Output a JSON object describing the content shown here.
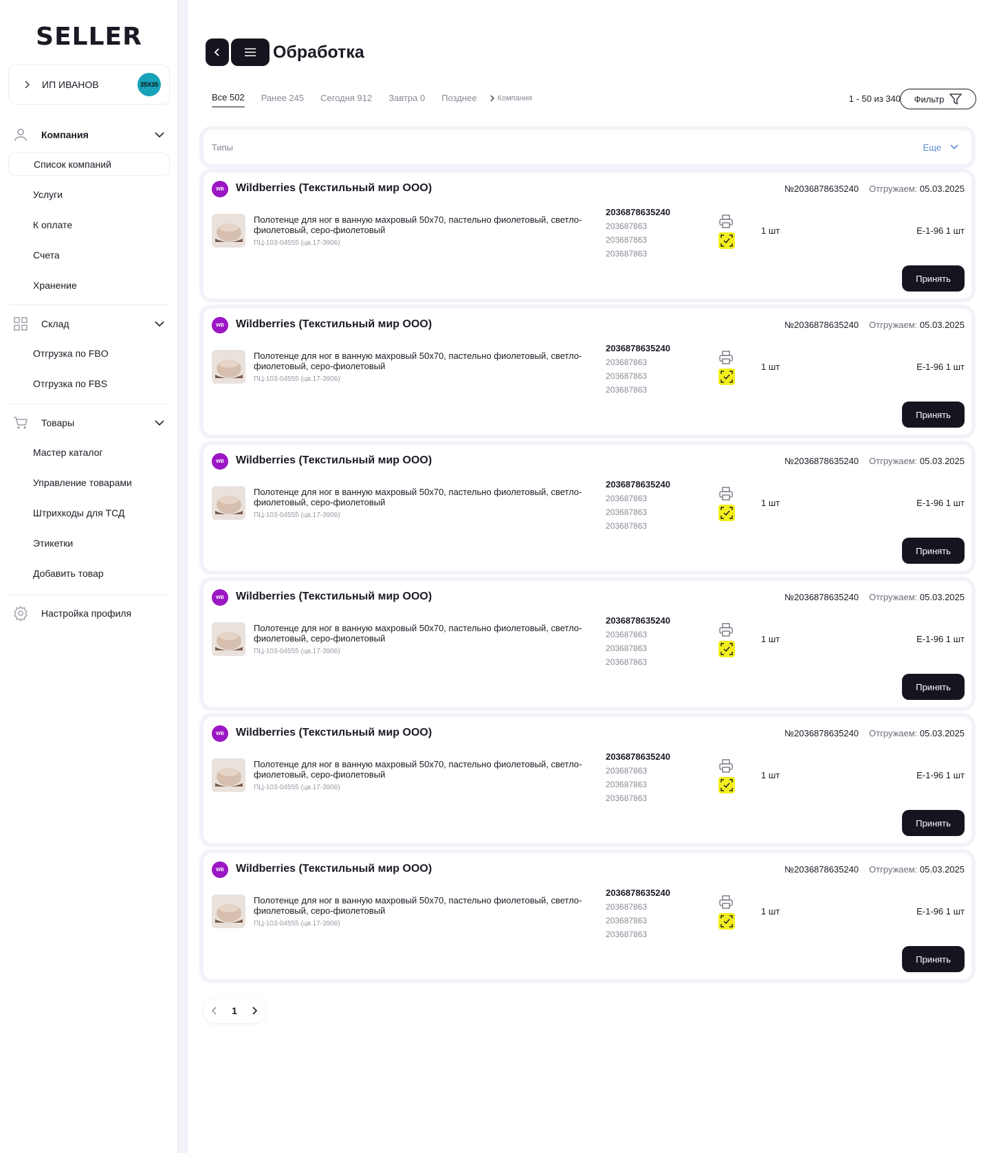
{
  "brand": "SELLER",
  "account": {
    "name": "ИП ИВАНОВ",
    "avatar_text": "35Х35"
  },
  "sidebar": {
    "company": {
      "label": "Компания",
      "items": [
        "Список компаний",
        "Услуги",
        "К оплате",
        "Счета",
        "Хранение"
      ]
    },
    "warehouse": {
      "label": "Склад",
      "items": [
        "Отгрузка по FBO",
        "Отгрузка по FBS"
      ]
    },
    "goods": {
      "label": "Товары",
      "items": [
        "Мастер каталог",
        "Управление товарами",
        "Штрихкоды для ТСД",
        "Этикетки",
        "Добавить товар"
      ]
    },
    "settings": {
      "label": "Настройка профиля"
    }
  },
  "header": {
    "title": "Обработка",
    "tabs": [
      "Все 502",
      "Ранее 245",
      "Сегодня 912",
      "Завтра 0",
      "Позднее"
    ],
    "crumb": "Компания",
    "range": "1 - 50 из 340",
    "filter_label": "Фильтр"
  },
  "types": {
    "label": "Типы",
    "more": "Еще"
  },
  "order_card": {
    "brand_badge": "WB",
    "shop": "Wildberries (Текстильный мир ООО)",
    "order_no": "№2036878635240",
    "ship_label": "Отгружаем:",
    "ship_date": "05.03.2025",
    "product": "Полотенце для ног в ванную махровый 50x70, пастельно фиолетовый, светло-фиолетовый, серо-фиолетовый",
    "sku": "ПЦ-103-04555 (цв.17-3906)",
    "code_main": "2036878635240",
    "codes": [
      "203687863",
      "203687863",
      "203687863"
    ],
    "qty": "1 шт",
    "cell": "Е-1-96 1 шт",
    "accept": "Принять"
  },
  "pager": {
    "current": "1"
  },
  "colors": {
    "dark": "#16151f",
    "brand_wb": "#9b17c4",
    "scan_yellow": "#f3ee1d",
    "link_blue": "#5a8bd8"
  }
}
